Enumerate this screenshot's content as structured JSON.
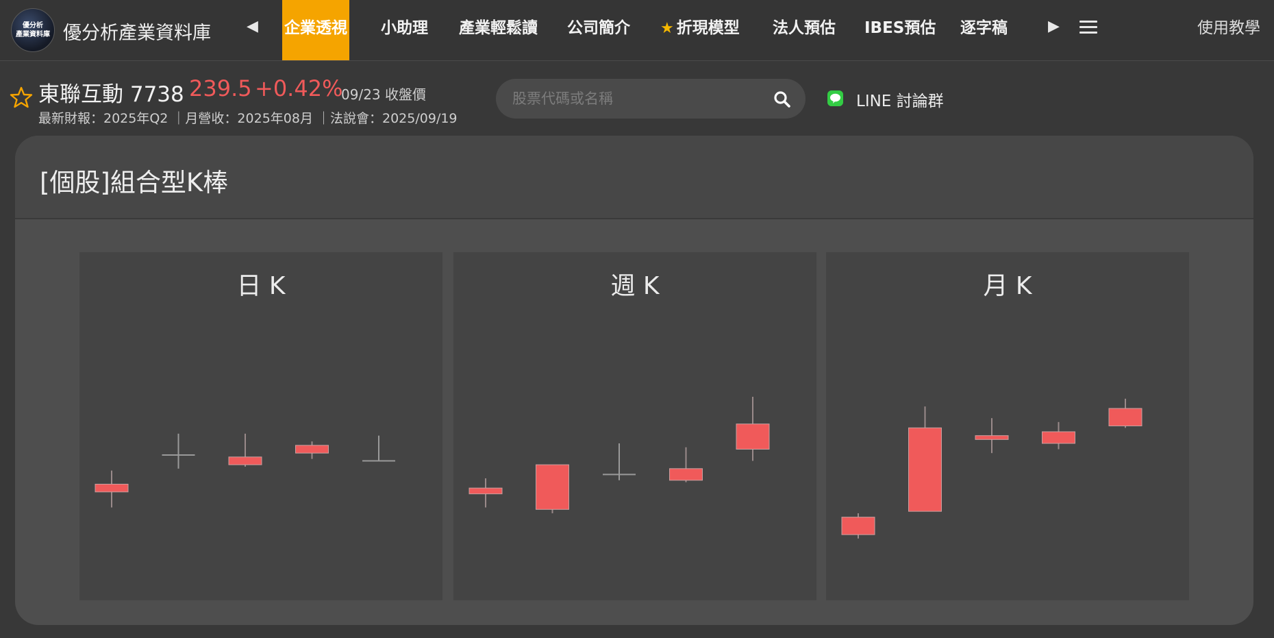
{
  "app": {
    "logo_text": [
      "優分析",
      "產業資料庫"
    ],
    "title": "優分析產業資料庫"
  },
  "nav": {
    "prev_arrow": "◀",
    "next_arrow": "▶",
    "items": [
      {
        "label": "企業透視",
        "active": true
      },
      {
        "label": "小助理"
      },
      {
        "label": "產業輕鬆讀"
      },
      {
        "label": "公司簡介"
      },
      {
        "label": "折現模型",
        "star": "★"
      },
      {
        "label": "法人預估"
      },
      {
        "label": "IBES預估"
      },
      {
        "label": "逐字稿"
      }
    ],
    "help": "使用教學"
  },
  "stock": {
    "name_code": "東聯互動 7738",
    "price": "239.5",
    "change": "+0.42%",
    "date_label": "09/23 收盤價",
    "meta": "最新財報：2025年Q2 ｜月營收：2025年08月 ｜法說會：2025/09/19"
  },
  "search": {
    "placeholder": "股票代碼或名稱",
    "value": ""
  },
  "line_group": {
    "label": "LINE 討論群"
  },
  "panel": {
    "title": "[個股]組合型K棒"
  },
  "colors": {
    "accent": "#f5a400",
    "up": "#f05a5a",
    "line_green": "#33cc44",
    "neutral_wick": "#9a9a9a"
  },
  "icons": {
    "favorite": "star-outline-icon",
    "search": "magnifier-icon",
    "line": "line-app-icon",
    "menu": "hamburger-icon"
  },
  "chart_data": [
    {
      "type": "candlestick",
      "title": "日 K",
      "candles": [
        {
          "open": 57,
          "close": 53,
          "high": 64,
          "low": 45
        },
        {
          "open": 72,
          "close": 72,
          "high": 83,
          "low": 65
        },
        {
          "open": 67,
          "close": 71,
          "high": 83,
          "low": 66
        },
        {
          "open": 73,
          "close": 77,
          "high": 79,
          "low": 70
        },
        {
          "open": 69,
          "close": 69,
          "high": 82,
          "low": 69
        }
      ]
    },
    {
      "type": "candlestick",
      "title": "週 K",
      "candles": [
        {
          "open": 52,
          "close": 55,
          "high": 60,
          "low": 45
        },
        {
          "open": 44,
          "close": 67,
          "high": 67,
          "low": 42
        },
        {
          "open": 62,
          "close": 62,
          "high": 78,
          "low": 59
        },
        {
          "open": 59,
          "close": 65,
          "high": 76,
          "low": 58
        },
        {
          "open": 75,
          "close": 88,
          "high": 102,
          "low": 69
        }
      ]
    },
    {
      "type": "candlestick",
      "title": "月 K",
      "candles": [
        {
          "open": 31,
          "close": 40,
          "high": 42,
          "low": 29
        },
        {
          "open": 43,
          "close": 86,
          "high": 97,
          "low": 43
        },
        {
          "open": 80,
          "close": 82,
          "high": 91,
          "low": 73
        },
        {
          "open": 78,
          "close": 84,
          "high": 89,
          "low": 75
        },
        {
          "open": 87,
          "close": 96,
          "high": 101,
          "low": 86
        }
      ]
    }
  ]
}
